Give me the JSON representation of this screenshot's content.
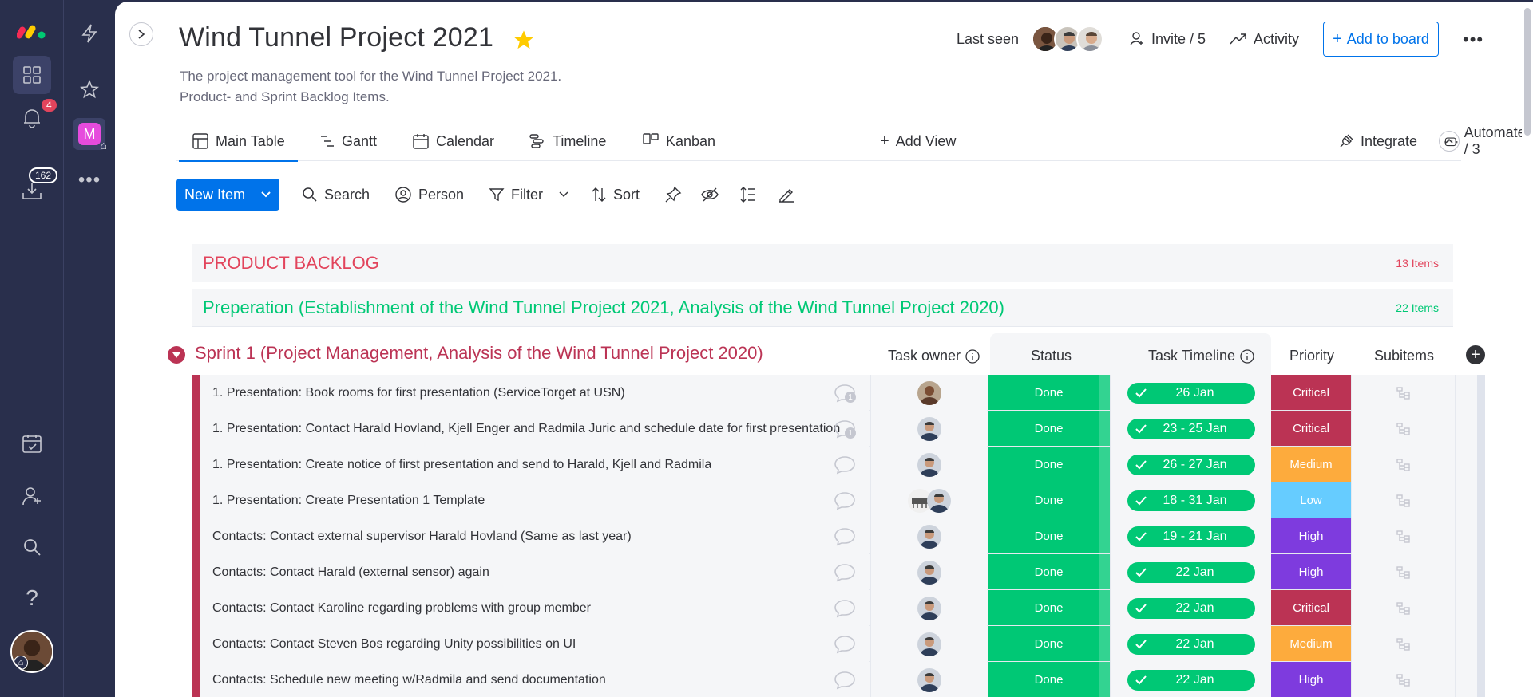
{
  "rail": {
    "notifications_badge": "4",
    "inbox_badge": "162"
  },
  "header": {
    "title": "Wind Tunnel Project 2021",
    "description_line1": "The project management tool for the Wind Tunnel Project 2021.",
    "description_line2": "Product- and Sprint Backlog Items.",
    "last_seen_label": "Last seen",
    "invite_label": "Invite / 5",
    "activity_label": "Activity",
    "add_to_board_label": "Add to board"
  },
  "tabs": [
    {
      "label": "Main Table",
      "icon": "table-home-icon"
    },
    {
      "label": "Gantt",
      "icon": "gantt-icon"
    },
    {
      "label": "Calendar",
      "icon": "calendar-icon"
    },
    {
      "label": "Timeline",
      "icon": "timeline-icon"
    },
    {
      "label": "Kanban",
      "icon": "kanban-icon"
    },
    {
      "label": "Add View",
      "icon": "plus-icon"
    }
  ],
  "tab_actions": {
    "integrate_label": "Integrate",
    "automate_label": "Automate / 3"
  },
  "toolbar": {
    "new_item_label": "New Item",
    "search_label": "Search",
    "person_label": "Person",
    "filter_label": "Filter",
    "sort_label": "Sort"
  },
  "groups": {
    "product_backlog": {
      "title": "PRODUCT BACKLOG",
      "count": "13 Items",
      "color": "#e2445c"
    },
    "preperation": {
      "title": "Preperation (Establishment of the Wind Tunnel Project 2021, Analysis of the Wind Tunnel Project 2020)",
      "count": "22 Items",
      "color": "#00c875"
    },
    "sprint1": {
      "title": "Sprint 1 (Project Management, Analysis of the Wind Tunnel Project 2020)",
      "color": "#bb3354"
    }
  },
  "columns": {
    "task_owner": "Task owner",
    "status": "Status",
    "task_timeline": "Task Timeline",
    "priority": "Priority",
    "subitems": "Subitems"
  },
  "rows": [
    {
      "name": "1. Presentation: Book rooms for first presentation (ServiceTorget at USN)",
      "comments": "1",
      "status": "Done",
      "timeline": "26 Jan",
      "priority": "Critical"
    },
    {
      "name": "1. Presentation: Contact Harald Hovland, Kjell Enger and Radmila Juric and schedule date for first presentation",
      "comments": "1",
      "status": "Done",
      "timeline": "23 - 25 Jan",
      "priority": "Critical"
    },
    {
      "name": "1. Presentation: Create notice of first presentation and send to Harald, Kjell and Radmila",
      "comments": "",
      "status": "Done",
      "timeline": "26 - 27 Jan",
      "priority": "Medium"
    },
    {
      "name": "1. Presentation: Create Presentation 1 Template",
      "comments": "",
      "status": "Done",
      "timeline": "18 - 31 Jan",
      "priority": "Low"
    },
    {
      "name": "Contacts: Contact external supervisor Harald Hovland (Same as last year)",
      "comments": "",
      "status": "Done",
      "timeline": "19 - 21 Jan",
      "priority": "High"
    },
    {
      "name": "Contacts: Contact Harald (external sensor) again",
      "comments": "",
      "status": "Done",
      "timeline": "22 Jan",
      "priority": "High"
    },
    {
      "name": "Contacts: Contact Karoline regarding problems with group member",
      "comments": "",
      "status": "Done",
      "timeline": "22 Jan",
      "priority": "Critical"
    },
    {
      "name": "Contacts: Contact Steven Bos regarding Unity possibilities on UI",
      "comments": "",
      "status": "Done",
      "timeline": "22 Jan",
      "priority": "Medium"
    },
    {
      "name": "Contacts: Schedule new meeting w/Radmila and send documentation",
      "comments": "",
      "status": "Done",
      "timeline": "22 Jan",
      "priority": "High"
    }
  ],
  "colors": {
    "accent": "#0073ea",
    "done": "#00c875",
    "critical": "#bb3354",
    "medium": "#fdab3d",
    "low": "#66ccff",
    "high": "#7e3bde"
  }
}
